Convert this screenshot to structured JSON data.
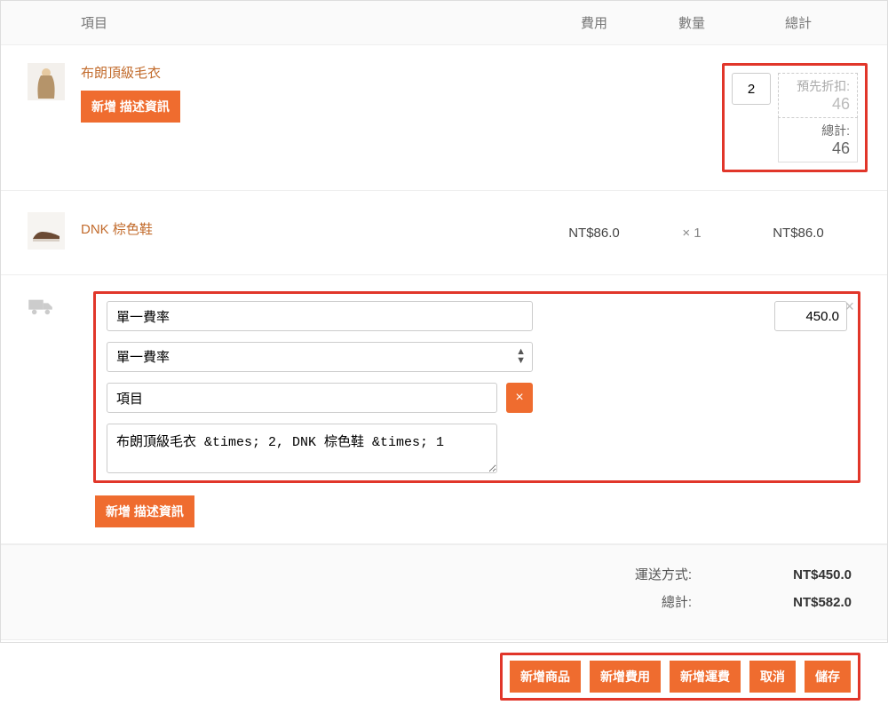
{
  "header": {
    "item": "項目",
    "cost": "費用",
    "qty": "數量",
    "total": "總計"
  },
  "items": [
    {
      "name": "布朗頂級毛衣",
      "add_desc_label": "新增 描述資訊",
      "qty_value": "2",
      "pre_discount_label": "預先折扣:",
      "pre_discount_value": "46",
      "total_label": "總計:",
      "total_value": "46"
    },
    {
      "name": "DNK 棕色鞋",
      "cost": "NT$86.0",
      "qty_display": "× 1",
      "total": "NT$86.0"
    }
  ],
  "shipping_edit": {
    "name_value": "單一費率",
    "method_selected": "單一費率",
    "item_label": "項目",
    "items_text": "布朗頂級毛衣 &times; 2, DNK 棕色鞋 &times; 1",
    "cost_value": "450.0",
    "add_desc_label": "新增 描述資訊",
    "remove_glyph": "×",
    "close_glyph": "×"
  },
  "totals": {
    "shipping_label": "運送方式:",
    "shipping_value": "NT$450.0",
    "grand_label": "總計:",
    "grand_value": "NT$582.0"
  },
  "actions": {
    "add_product": "新增商品",
    "add_fee": "新增費用",
    "add_shipping": "新增運費",
    "cancel": "取消",
    "save": "儲存"
  }
}
